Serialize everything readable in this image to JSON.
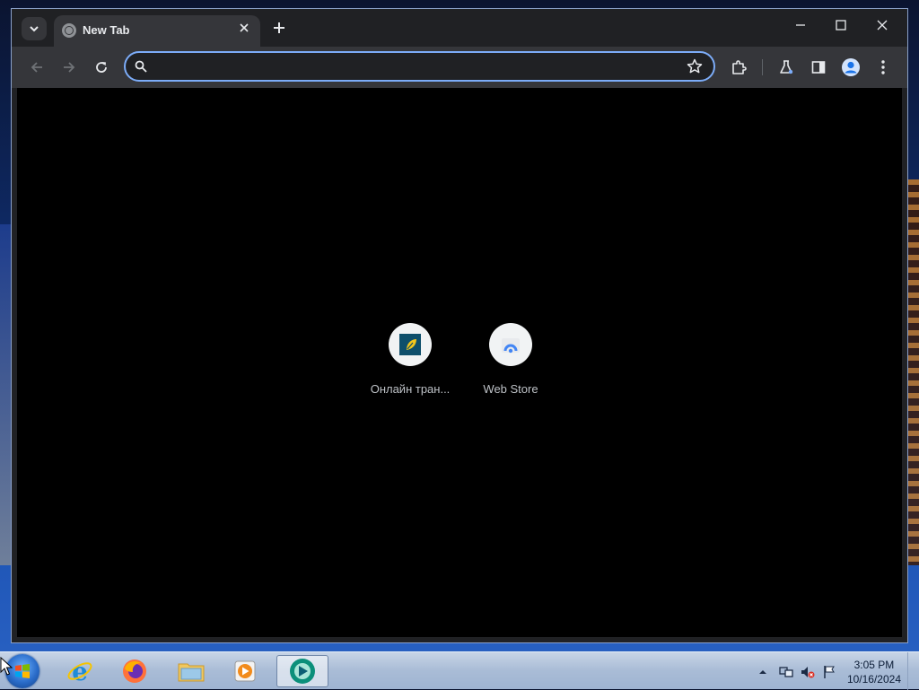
{
  "browser": {
    "tab_title": "New Tab",
    "omnibox": {
      "value": "",
      "placeholder": ""
    }
  },
  "shortcuts": [
    {
      "label": "Онлайн тран..."
    },
    {
      "label": "Web Store"
    }
  ],
  "taskbar": {
    "time": "3:05 PM",
    "date": "10/16/2024"
  },
  "colors": {
    "accent": "#7cacf8",
    "window_bg": "#202124",
    "toolbar_bg": "#35363a",
    "page_bg": "#000000"
  }
}
